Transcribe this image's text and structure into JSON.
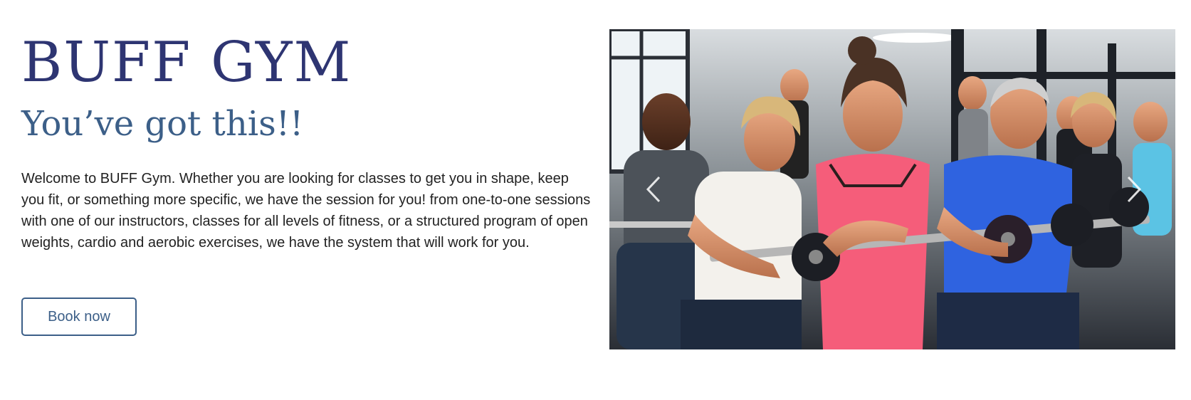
{
  "hero": {
    "title": "BUFF GYM",
    "tagline": "You’ve got this!!",
    "intro": "Welcome to BUFF Gym. Whether you are looking for classes to get you in shape, keep you fit, or something more specific, we have the session for you! from one-to-one sessions with one of our instructors, classes for all levels of fitness, or a structured program of open weights, cardio and aerobic exercises, we have the system that will work for you.",
    "book_button_label": "Book now"
  },
  "carousel": {
    "prev_icon": "chevron-left-icon",
    "next_icon": "chevron-right-icon",
    "image_alt": "People lifting barbells in a gym class"
  },
  "colors": {
    "title": "#2e3572",
    "accent": "#3c5f88",
    "body_text": "#222222",
    "background": "#ffffff"
  }
}
